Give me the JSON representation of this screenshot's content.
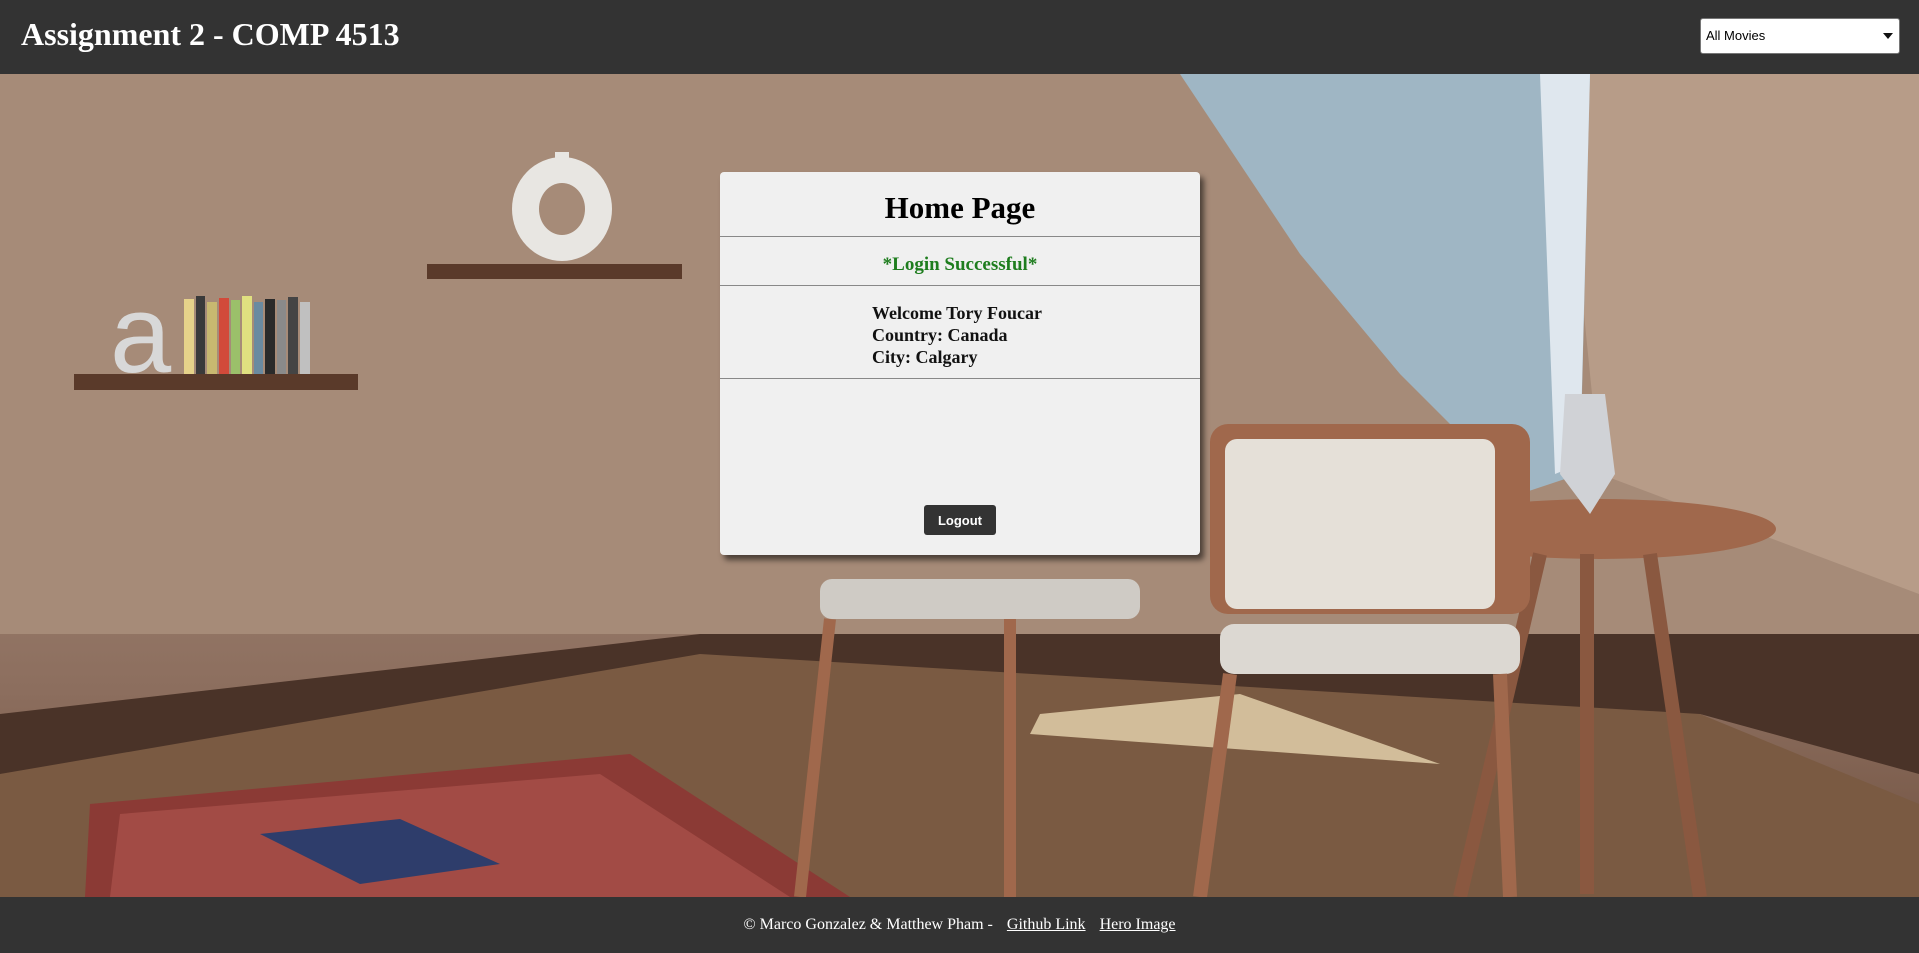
{
  "header": {
    "title": "Assignment 2 - COMP 4513",
    "movie_filter": {
      "selected": "All Movies"
    }
  },
  "hero": {
    "description_icon": "room-interior-image"
  },
  "card": {
    "title": "Home Page",
    "status": "*Login Successful*",
    "welcome": "Welcome Tory Foucar",
    "country": "Country: Canada",
    "city": "City: Calgary",
    "logout_label": "Logout"
  },
  "footer": {
    "copyright": "© Marco Gonzalez & Matthew Pham -",
    "github_link": "Github Link",
    "hero_image_link": "Hero Image"
  },
  "colors": {
    "header_bg": "#333333",
    "card_bg": "#f0f0f0",
    "status_green": "#1e7d1e"
  }
}
